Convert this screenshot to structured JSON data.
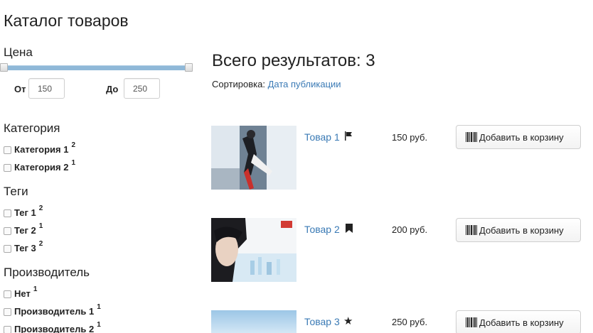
{
  "page": {
    "title": "Каталог товаров"
  },
  "filters": {
    "price": {
      "title": "Цена",
      "from_label": "От",
      "from_value": "150",
      "to_label": "До",
      "to_value": "250"
    },
    "categories": {
      "title": "Категория",
      "items": [
        {
          "label": "Категория 1",
          "count": "2"
        },
        {
          "label": "Категория 2",
          "count": "1"
        }
      ]
    },
    "tags": {
      "title": "Теги",
      "items": [
        {
          "label": "Тег 1",
          "count": "2"
        },
        {
          "label": "Тег 2",
          "count": "1"
        },
        {
          "label": "Тег 3",
          "count": "2"
        }
      ]
    },
    "manufacturers": {
      "title": "Производитель",
      "items": [
        {
          "label": "Нет",
          "count": "1"
        },
        {
          "label": "Производитель 1",
          "count": "1"
        },
        {
          "label": "Производитель 2",
          "count": "1"
        }
      ]
    }
  },
  "results": {
    "title": "Всего результатов: 3",
    "sort_label": "Сортировка:",
    "sort_value": "Дата публикации",
    "products": [
      {
        "name": "Товар 1",
        "icon": "flag-icon",
        "glyph": "⚑",
        "price": "150 руб.",
        "button": "Добавить в корзину"
      },
      {
        "name": "Товар 2",
        "icon": "bookmark-icon",
        "glyph": "",
        "price": "200 руб.",
        "button": "Добавить в корзину"
      },
      {
        "name": "Товар 3",
        "icon": "star-icon",
        "glyph": "★",
        "price": "250 руб.",
        "button": "Добавить в корзину"
      }
    ]
  }
}
